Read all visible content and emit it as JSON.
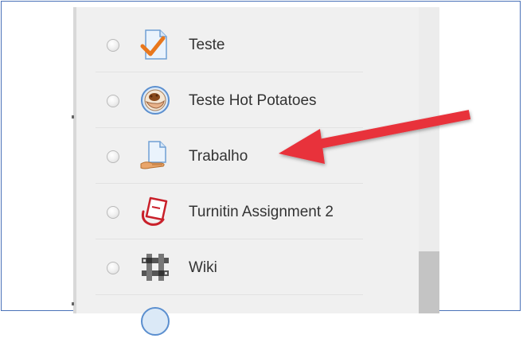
{
  "activities": [
    {
      "label": "Teste",
      "icon": "quiz-checkmark-icon"
    },
    {
      "label": "Teste Hot Potatoes",
      "icon": "hot-potatoes-icon"
    },
    {
      "label": "Trabalho",
      "icon": "assignment-hand-icon"
    },
    {
      "label": "Turnitin Assignment 2",
      "icon": "turnitin-icon"
    },
    {
      "label": "Wiki",
      "icon": "wiki-icon"
    }
  ],
  "colors": {
    "arrow": "#e8303a",
    "frame_border": "#4a72b8",
    "panel_bg": "#f0f0f0"
  }
}
